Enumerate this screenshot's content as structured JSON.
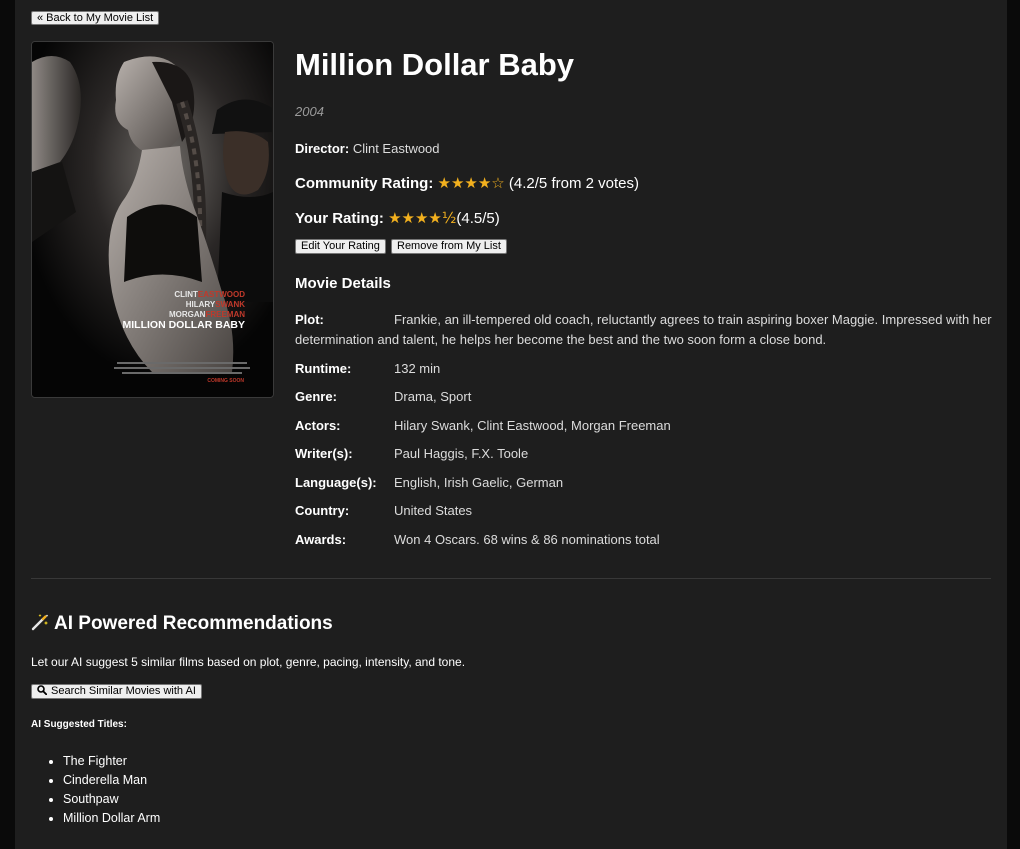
{
  "nav": {
    "back_label": "« Back to My Movie List"
  },
  "poster": {
    "credit_first_names": [
      "CLINT",
      "HILARY",
      "MORGAN"
    ],
    "credit_last_names": [
      "EASTWOOD",
      "SWANK",
      "FREEMAN"
    ],
    "poster_title": "MILLION DOLLAR BABY",
    "release_note": "COMING SOON",
    "accent_color": "#c0392b"
  },
  "movie": {
    "title": "Million Dollar Baby",
    "year": "2004",
    "director_label": "Director:",
    "director": "Clint Eastwood"
  },
  "ratings": {
    "community_label": "Community Rating:",
    "community_stars": "★★★★☆",
    "community_text": "(4.2/5 from 2 votes)",
    "community_value": 4.2,
    "community_votes": 2,
    "your_label": "Your Rating:",
    "your_stars": "★★★★½",
    "your_text": "(4.5/5)",
    "your_value": 4.5,
    "star_color": "#f2b01e"
  },
  "actions": {
    "edit_label": "Edit Your Rating",
    "remove_label": "Remove from My List"
  },
  "details": {
    "heading": "Movie Details",
    "plot_label": "Plot:",
    "plot": "Frankie, an ill-tempered old coach, reluctantly agrees to train aspiring boxer Maggie. Impressed with her determination and talent, he helps her become the best and the two soon form a close bond.",
    "rows": [
      {
        "label": "Runtime:",
        "value": "132 min"
      },
      {
        "label": "Genre:",
        "value": "Drama, Sport"
      },
      {
        "label": "Actors:",
        "value": "Hilary Swank, Clint Eastwood, Morgan Freeman"
      },
      {
        "label": "Writer(s):",
        "value": "Paul Haggis, F.X. Toole"
      },
      {
        "label": "Language(s):",
        "value": "English, Irish Gaelic, German"
      },
      {
        "label": "Country:",
        "value": "United States"
      },
      {
        "label": "Awards:",
        "value": "Won 4 Oscars. 68 wins & 86 nominations total"
      }
    ]
  },
  "ai": {
    "icon": "magic-wand-icon",
    "heading": "AI Powered Recommendations",
    "description": "Let our AI suggest 5 similar films based on plot, genre, pacing, intensity, and tone.",
    "search_icon": "search-icon",
    "button_label": "Search Similar Movies with AI",
    "suggested_label": "AI Suggested Titles:",
    "suggestions": [
      "The Fighter",
      "Cinderella Man",
      "Southpaw",
      "Million Dollar Arm"
    ]
  }
}
